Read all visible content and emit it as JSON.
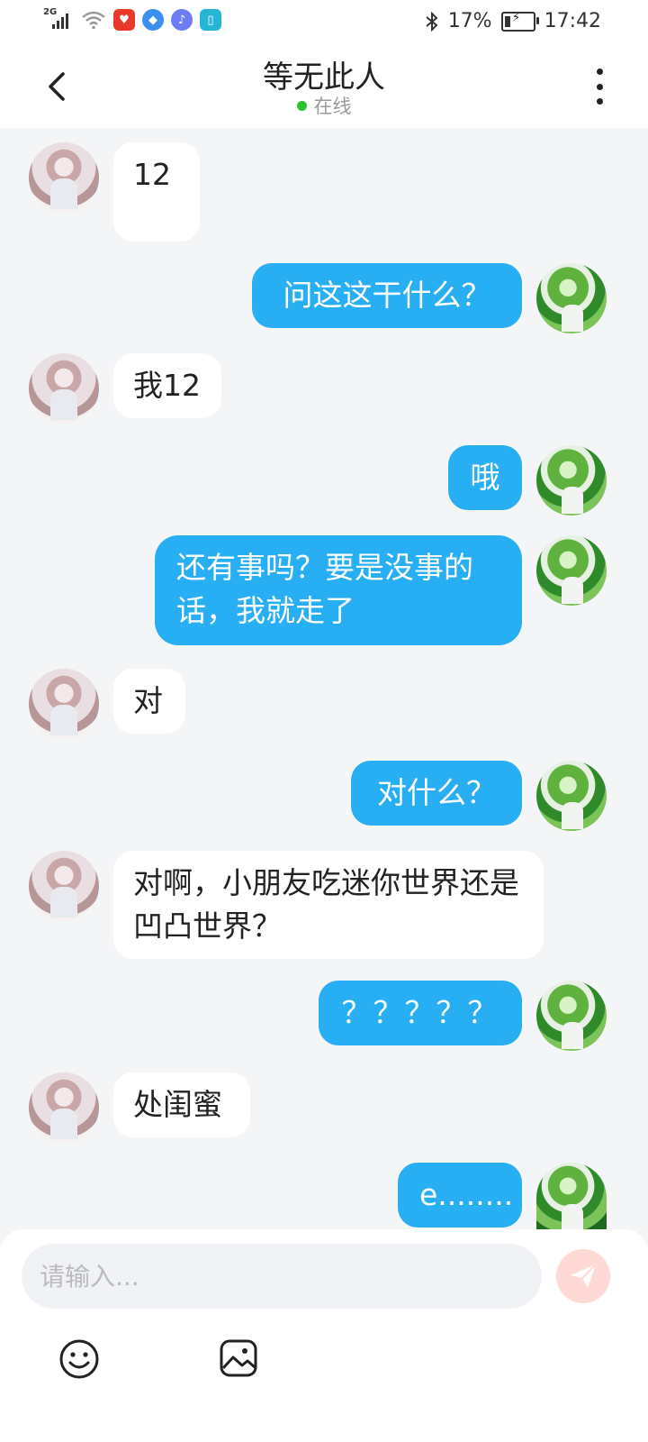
{
  "status_bar": {
    "network": "2G",
    "battery": "17%",
    "time": "17:42"
  },
  "header": {
    "title": "等无此人",
    "status": "在线"
  },
  "messages": [
    {
      "side": "in",
      "text": "12"
    },
    {
      "side": "out",
      "text": "问这这干什么？"
    },
    {
      "side": "in",
      "text": "我12"
    },
    {
      "side": "out",
      "text": "哦"
    },
    {
      "side": "out",
      "text": "还有事吗？要是没事的话，我就走了"
    },
    {
      "side": "in",
      "text": "对"
    },
    {
      "side": "out",
      "text": "对什么？"
    },
    {
      "side": "in",
      "text": "对啊，小朋友吃迷你世界还是凹凸世界？"
    },
    {
      "side": "out",
      "text": "？？？？？"
    },
    {
      "side": "in",
      "text": "处闺蜜"
    },
    {
      "side": "out",
      "text": "e........"
    }
  ],
  "input": {
    "placeholder": "请输入...",
    "value": ""
  },
  "icons": {
    "back": "chevron-left-icon",
    "more": "more-vertical-icon",
    "send": "send-icon",
    "emoji": "emoji-icon",
    "image": "image-icon"
  },
  "colors": {
    "outgoing_bubble": "#28aff3",
    "incoming_bubble": "#ffffff",
    "background": "#f4f5f7",
    "online_dot": "#2ec22e",
    "send_button": "#ffd9d5"
  }
}
